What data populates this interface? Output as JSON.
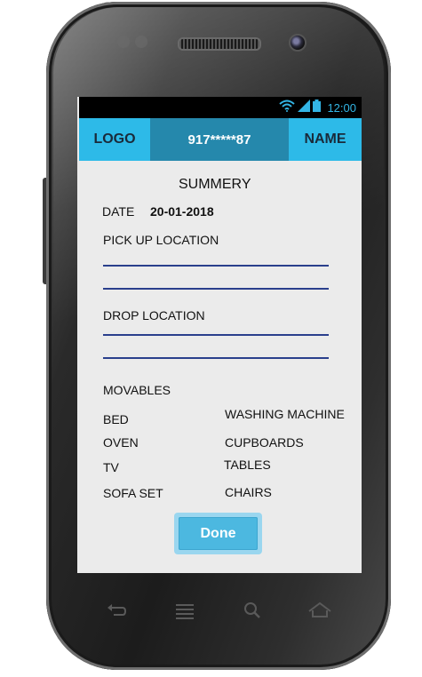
{
  "status_bar": {
    "time": "12:00",
    "icons": [
      "wifi-icon",
      "signal-icon",
      "battery-icon"
    ]
  },
  "header": {
    "logo": "LOGO",
    "phone_number": "917*****87",
    "name": "NAME"
  },
  "summary": {
    "title": "SUMMERY",
    "date_label": "DATE",
    "date_value": "20-01-2018",
    "pickup_label": "PICK UP LOCATION",
    "drop_label": "DROP LOCATION",
    "movables_label": "MOVABLES",
    "movables": [
      "BED",
      "WASHING MACHINE",
      "OVEN",
      "CUPBOARDS",
      "TV",
      "TABLES",
      "SOFA SET",
      "CHAIRS"
    ],
    "done_label": "Done"
  },
  "device_keys": [
    "back-icon",
    "menu-icon",
    "search-icon",
    "home-icon"
  ],
  "colors": {
    "accent": "#2dbae8",
    "accent_dark": "#2588ac",
    "button": "#4cb8e0",
    "line": "#2a3f8c"
  }
}
